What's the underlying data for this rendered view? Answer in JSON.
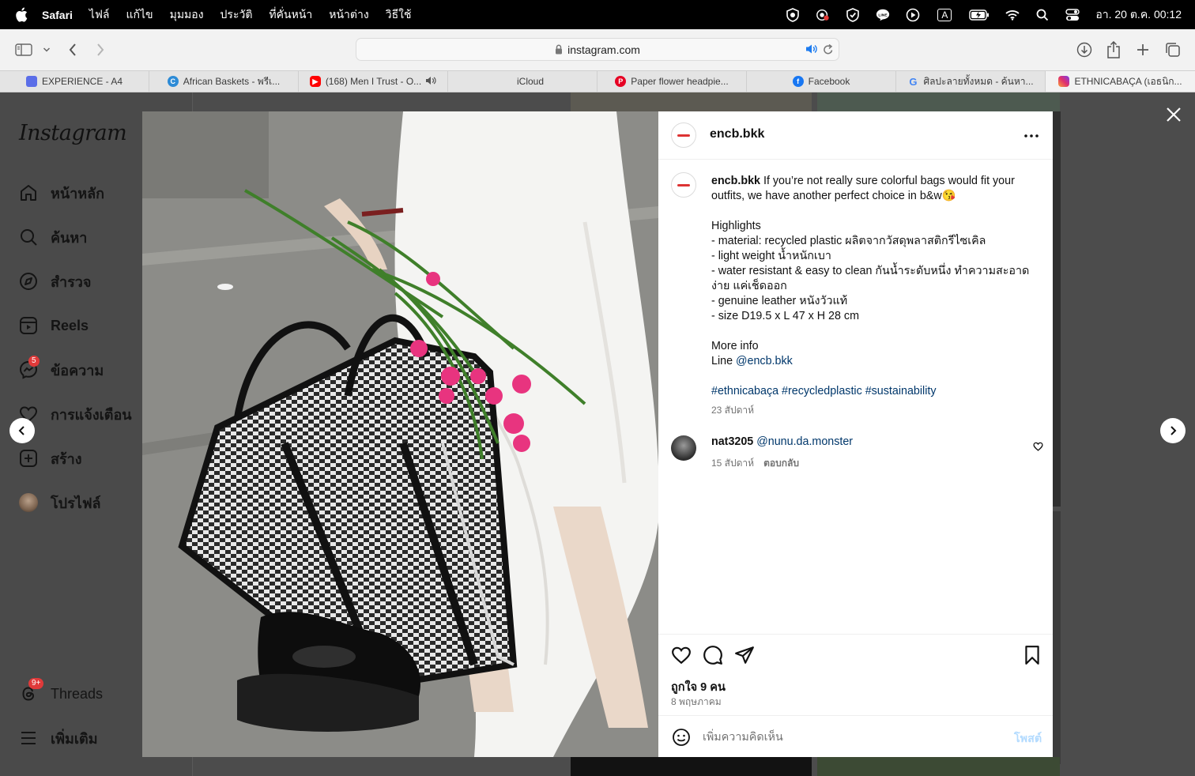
{
  "menubar": {
    "app": "Safari",
    "items": [
      "ไฟล์",
      "แก้ไข",
      "มุมมอง",
      "ประวัติ",
      "ที่คั่นหน้า",
      "หน้าต่าง",
      "วิธีใช้"
    ],
    "status_icons": [
      "shield-icon",
      "record-icon",
      "check-shield-icon",
      "line-icon",
      "play-circle-icon",
      "input-source-icon",
      "battery-icon",
      "wifi-icon",
      "spotlight-search-icon",
      "control-center-icon"
    ],
    "input_source": "A",
    "clock": "อา. 20 ต.ค.  00:12"
  },
  "browser": {
    "url": "instagram.com",
    "tabs": [
      {
        "title": "EXPERIENCE - A4",
        "icon": "app-icon"
      },
      {
        "title": "African Baskets - พรีเ...",
        "icon": "c-icon"
      },
      {
        "title": "(168) Men I Trust - O...",
        "icon": "youtube-icon"
      },
      {
        "title": "iCloud",
        "icon": "apple-icon"
      },
      {
        "title": "Paper flower headpie...",
        "icon": "pinterest-icon"
      },
      {
        "title": "Facebook",
        "icon": "facebook-icon"
      },
      {
        "title": "ศิลปะลายทั้งหมด - ค้นหา...",
        "icon": "google-icon"
      },
      {
        "title": "ETHNICABAÇA (เอธนิก...",
        "icon": "instagram-icon"
      }
    ]
  },
  "instagram": {
    "logo": "Instagram",
    "nav": [
      {
        "label": "หน้าหลัก",
        "icon": "home-icon"
      },
      {
        "label": "ค้นหา",
        "icon": "search-icon"
      },
      {
        "label": "สำรวจ",
        "icon": "compass-icon"
      },
      {
        "label": "Reels",
        "icon": "reels-icon"
      },
      {
        "label": "ข้อความ",
        "icon": "messenger-icon",
        "badge": "5"
      },
      {
        "label": "การแจ้งเตือน",
        "icon": "heart-icon"
      },
      {
        "label": "สร้าง",
        "icon": "plus-square-icon"
      },
      {
        "label": "โปรไฟล์",
        "icon": "profile-avatar"
      }
    ],
    "bottom_nav": [
      {
        "label": "Threads",
        "icon": "threads-icon",
        "badge": "9+"
      },
      {
        "label": "เพิ่มเติม",
        "icon": "menu-icon"
      }
    ]
  },
  "post": {
    "username": "encb.bkk",
    "caption_lines": [
      "If you’re not really sure colorful bags would fit your",
      "outfits, we have another perfect choice in b&w😘",
      "",
      "Highlights",
      "- material: recycled plastic ผลิตจากวัสดุพลาสติกรีไซเคิล",
      "- light weight น้ำหนักเบา",
      "- water resistant & easy to clean กันน้ำระดับหนึ่ง ทำความสะอาด",
      "ง่าย แค่เช็ดออก",
      "- genuine leather หนังวัวแท้",
      "- size D19.5 x L 47 x H 28 cm",
      "",
      "More info"
    ],
    "line_prefix": "Line ",
    "line_handle": "@encb.bkk",
    "hashtags": "#ethnicabaça #recycledplastic #sustainability",
    "caption_age": "23 สัปดาห์",
    "comment": {
      "username": "nat3205",
      "mention": "@nunu.da.monster",
      "age": "15 สัปดาห์",
      "reply_label": "ตอบกลับ"
    },
    "likes": "ถูกใจ 9 คน",
    "date": "8 พฤษภาคม",
    "comment_placeholder": "เพิ่มความคิดเห็น",
    "post_button": "โพสต์"
  }
}
